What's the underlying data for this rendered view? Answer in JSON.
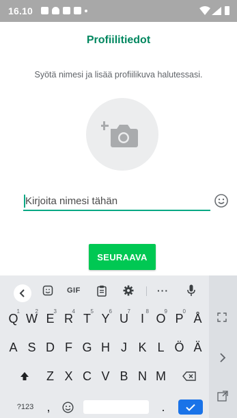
{
  "status_bar": {
    "time": "16.10"
  },
  "screen": {
    "title": "Profiilitiedot",
    "subtitle": "Syötä nimesi ja lisää profiilikuva halutessasi.",
    "name_placeholder": "Kirjoita nimesi tähän",
    "name_value": "",
    "next_label": "SEURAAVA"
  },
  "colors": {
    "accent": "#00875f",
    "button": "#00c853",
    "underline": "#00a884",
    "enter_key": "#1a73e8"
  },
  "keyboard": {
    "toolbar": {
      "gif_label": "GIF",
      "more_label": "···"
    },
    "row1": [
      {
        "label": "Q",
        "hint": "1"
      },
      {
        "label": "W",
        "hint": "2"
      },
      {
        "label": "E",
        "hint": "3"
      },
      {
        "label": "R",
        "hint": "4"
      },
      {
        "label": "T",
        "hint": "5"
      },
      {
        "label": "Y",
        "hint": "6"
      },
      {
        "label": "U",
        "hint": "7"
      },
      {
        "label": "I",
        "hint": "8"
      },
      {
        "label": "O",
        "hint": "9"
      },
      {
        "label": "P",
        "hint": "0"
      },
      {
        "label": "Å",
        "hint": ""
      }
    ],
    "row2": [
      "A",
      "S",
      "D",
      "F",
      "G",
      "H",
      "J",
      "K",
      "L",
      "Ö",
      "Ä"
    ],
    "row3": [
      "Z",
      "X",
      "C",
      "V",
      "B",
      "N",
      "M"
    ],
    "symbols_label": "?123",
    "comma_label": ",",
    "period_label": "."
  }
}
